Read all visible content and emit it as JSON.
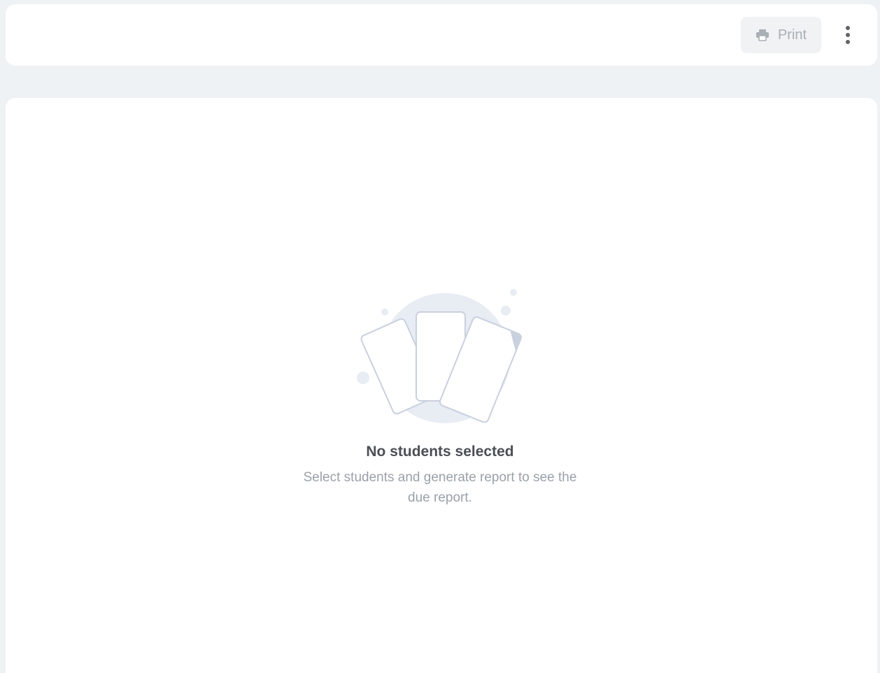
{
  "toolbar": {
    "print_label": "Print",
    "print_icon": "printer-icon",
    "more_icon": "more-vertical-icon"
  },
  "empty_state": {
    "illustration": "empty-cards-illustration",
    "title": "No students selected",
    "subtitle": "Select students and generate report to see the due report."
  },
  "colors": {
    "background": "#eef2f5",
    "surface": "#ffffff",
    "title_text": "#4a4f55",
    "subtitle_text": "#9aa1a9",
    "illustration_fill": "#e8ecf3",
    "illustration_stroke": "#c9d0de"
  }
}
